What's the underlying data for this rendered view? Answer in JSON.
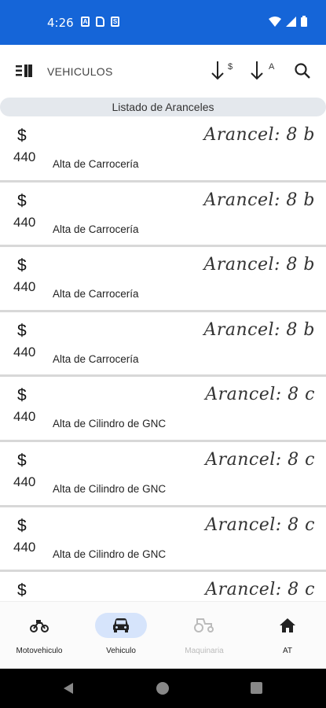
{
  "status_bar": {
    "time": "4:26",
    "icons": [
      "app-a-icon",
      "sd-card-icon",
      "app-s-icon"
    ],
    "right_icons": [
      "wifi-icon",
      "signal-icon",
      "battery-icon"
    ]
  },
  "toolbar": {
    "title": "VEHICULOS",
    "sort_price_sub": "$",
    "sort_alpha_sub": "A"
  },
  "section_header": "Listado de Aranceles",
  "items": [
    {
      "currency": "$",
      "price": "440",
      "description": "Alta de Carrocería",
      "arancel": "Arancel: 8 b"
    },
    {
      "currency": "$",
      "price": "440",
      "description": "Alta de Carrocería",
      "arancel": "Arancel: 8 b"
    },
    {
      "currency": "$",
      "price": "440",
      "description": "Alta de Carrocería",
      "arancel": "Arancel: 8 b"
    },
    {
      "currency": "$",
      "price": "440",
      "description": "Alta de Carrocería",
      "arancel": "Arancel: 8 b"
    },
    {
      "currency": "$",
      "price": "440",
      "description": "Alta de Cilindro de GNC",
      "arancel": "Arancel: 8 c"
    },
    {
      "currency": "$",
      "price": "440",
      "description": "Alta de Cilindro de GNC",
      "arancel": "Arancel: 8 c"
    },
    {
      "currency": "$",
      "price": "440",
      "description": "Alta de Cilindro de GNC",
      "arancel": "Arancel: 8 c"
    },
    {
      "currency": "$",
      "price": "",
      "description": "",
      "arancel": "Arancel: 8 c"
    }
  ],
  "bottom_nav": [
    {
      "label": "Motovehiculo",
      "icon": "motorcycle-icon",
      "state": "normal"
    },
    {
      "label": "Vehiculo",
      "icon": "car-icon",
      "state": "active"
    },
    {
      "label": "Maquinaria",
      "icon": "tractor-icon",
      "state": "disabled"
    },
    {
      "label": "AT",
      "icon": "home-icon",
      "state": "normal"
    }
  ],
  "colors": {
    "status_bar": "#1565d8",
    "active_pill": "#d6e4fb",
    "section_header": "#e4e8ed"
  }
}
